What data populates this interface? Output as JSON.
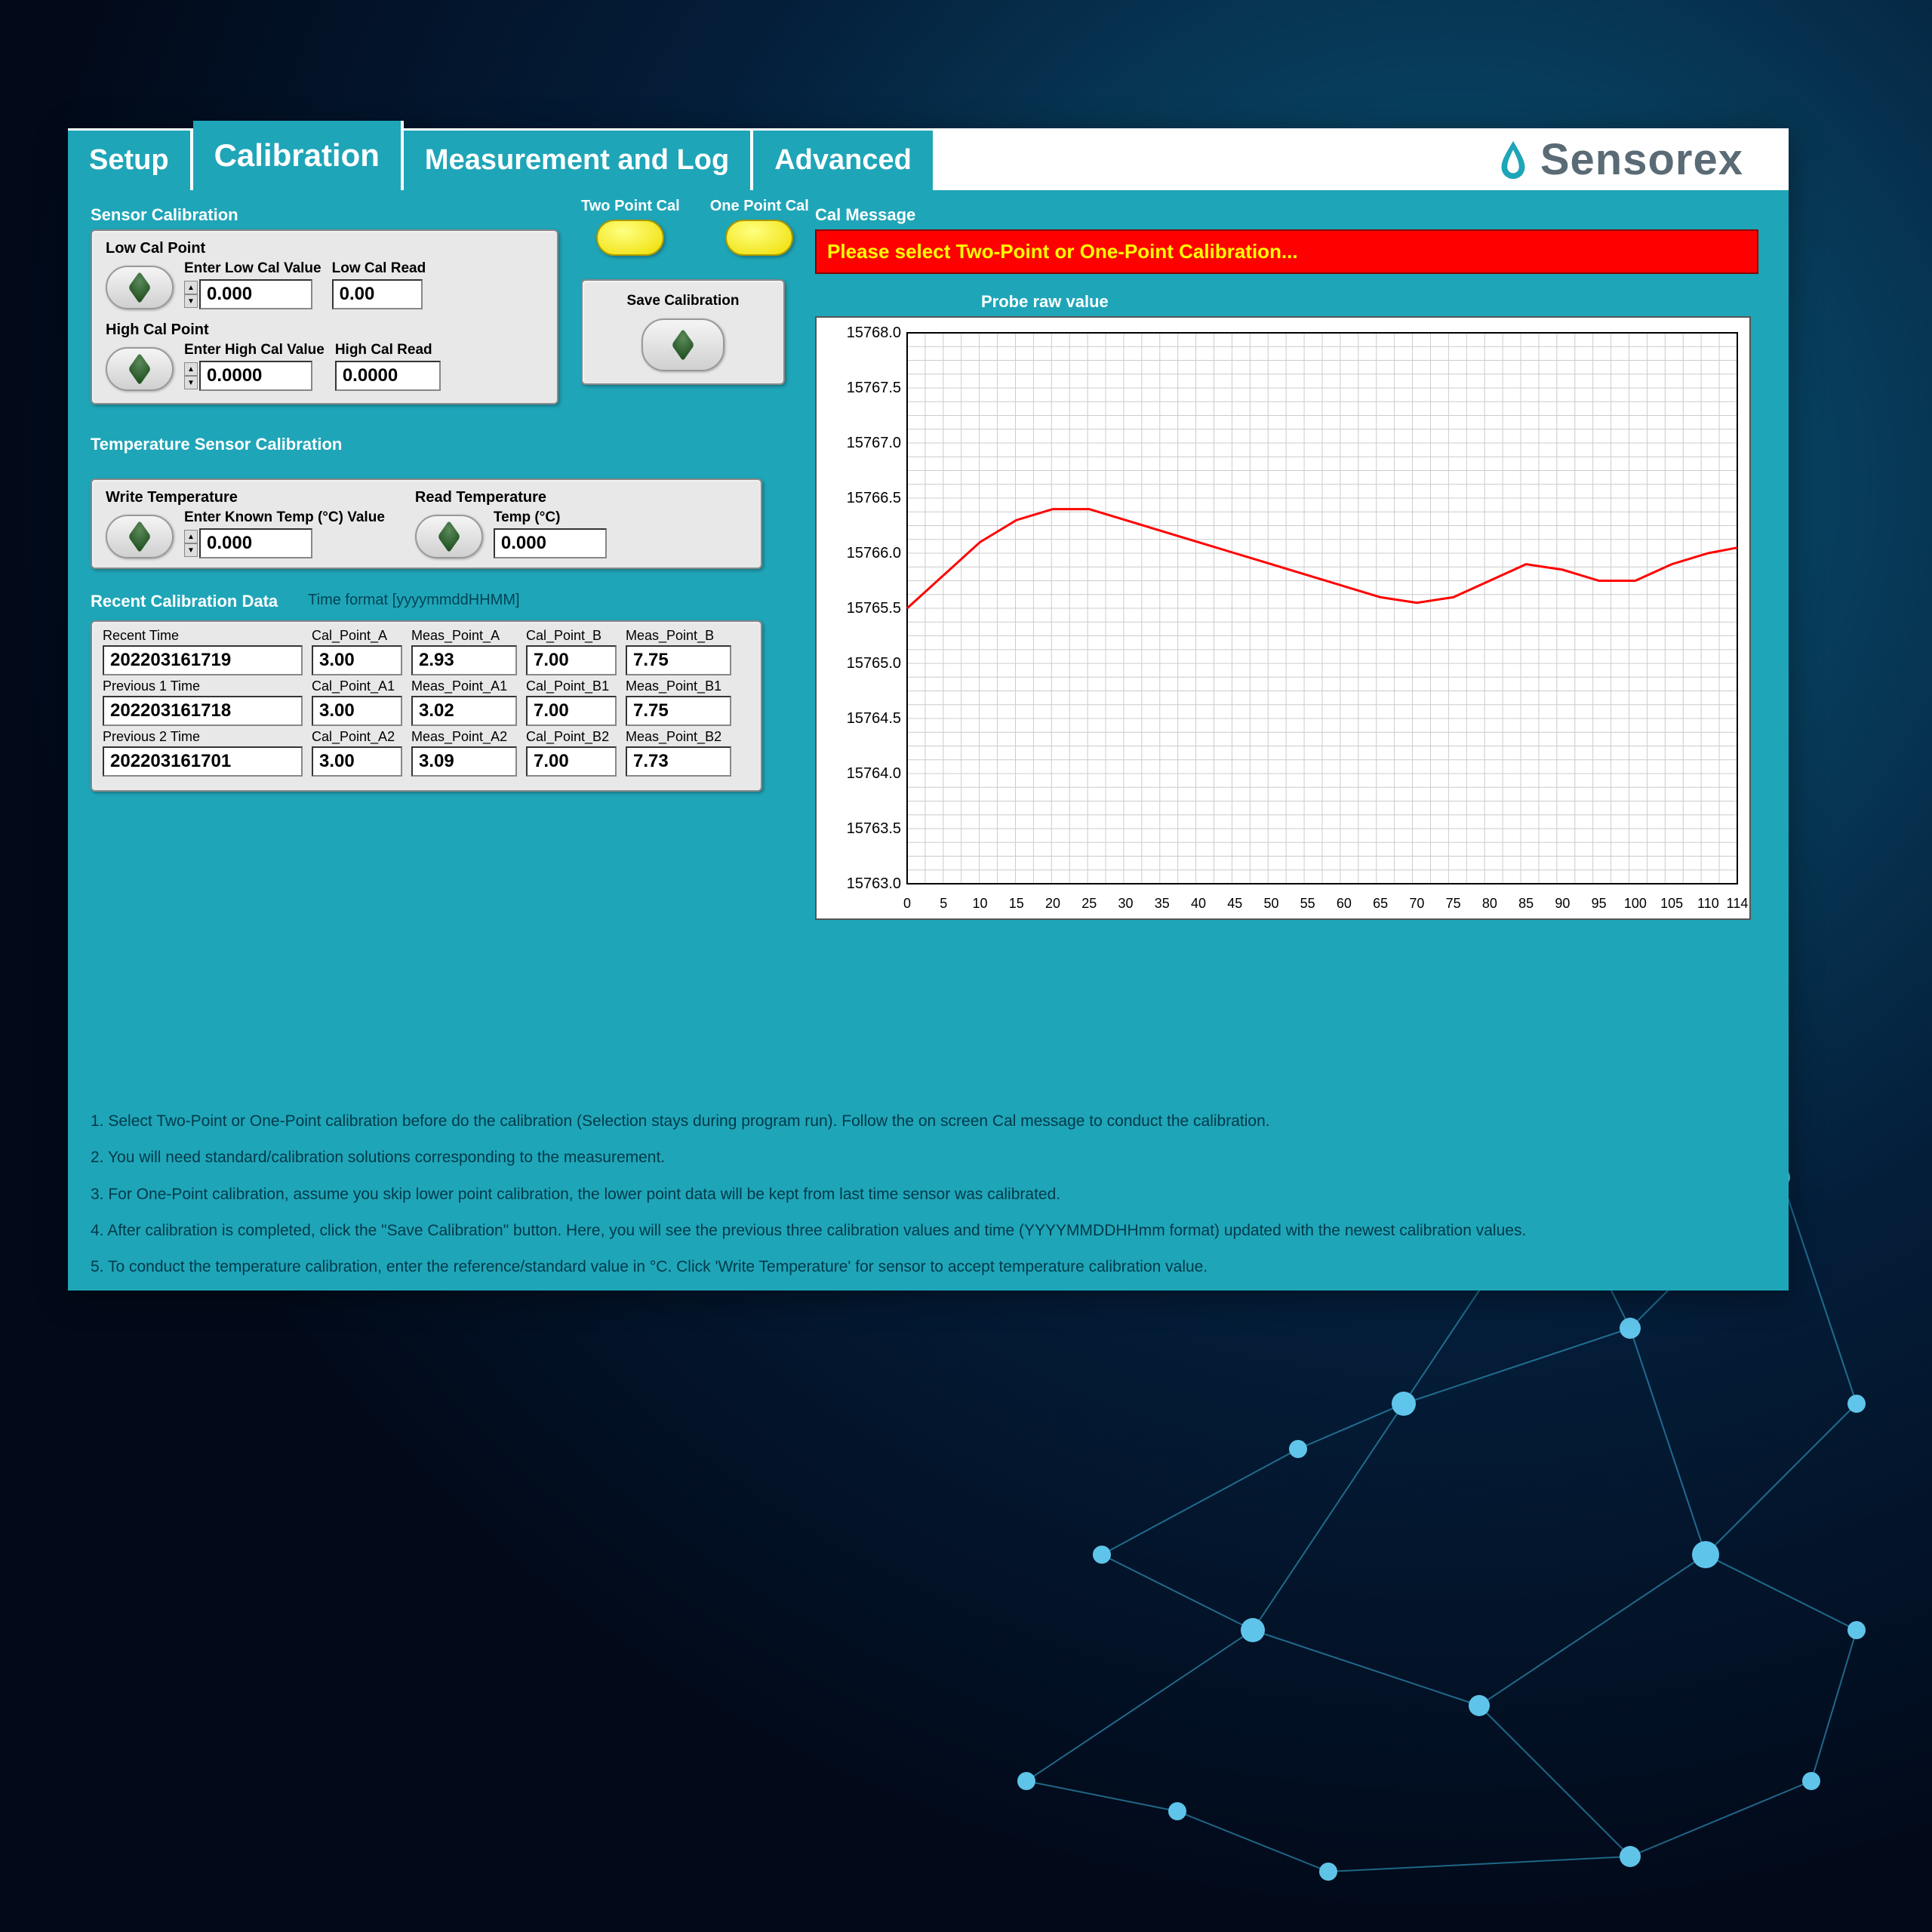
{
  "brand": "Sensorex",
  "tabs": {
    "setup": "Setup",
    "calibration": "Calibration",
    "measurement": "Measurement and Log",
    "advanced": "Advanced"
  },
  "sensor_cal": {
    "section": "Sensor Calibration",
    "low_point_label": "Low Cal Point",
    "enter_low_label": "Enter Low Cal Value",
    "enter_low_value": "0.000",
    "low_read_label": "Low Cal Read",
    "low_read_value": "0.00",
    "high_point_label": "High Cal Point",
    "enter_high_label": "Enter High Cal Value",
    "enter_high_value": "0.0000",
    "high_read_label": "High Cal Read",
    "high_read_value": "0.0000"
  },
  "cal_toggles": {
    "two_point": "Two Point Cal",
    "one_point": "One Point Cal"
  },
  "save_cal": {
    "label": "Save Calibration"
  },
  "temp_cal": {
    "section": "Temperature Sensor Calibration",
    "write_label": "Write Temperature",
    "known_label": "Enter Known Temp (°C) Value",
    "known_value": "0.000",
    "read_label": "Read Temperature",
    "temp_label": "Temp (°C)",
    "temp_value": "0.000"
  },
  "recent": {
    "section": "Recent Calibration Data",
    "time_format": "Time format [yyyymmddHHMM]",
    "rows": [
      {
        "time_label": "Recent Time",
        "time": "202203161719",
        "calA_label": "Cal_Point_A",
        "calA": "3.00",
        "measA_label": "Meas_Point_A",
        "measA": "2.93",
        "calB_label": "Cal_Point_B",
        "calB": "7.00",
        "measB_label": "Meas_Point_B",
        "measB": "7.75"
      },
      {
        "time_label": "Previous 1 Time",
        "time": "202203161718",
        "calA_label": "Cal_Point_A1",
        "calA": "3.00",
        "measA_label": "Meas_Point_A1",
        "measA": "3.02",
        "calB_label": "Cal_Point_B1",
        "calB": "7.00",
        "measB_label": "Meas_Point_B1",
        "measB": "7.75"
      },
      {
        "time_label": "Previous 2 Time",
        "time": "202203161701",
        "calA_label": "Cal_Point_A2",
        "calA": "3.00",
        "measA_label": "Meas_Point_A2",
        "measA": "3.09",
        "calB_label": "Cal_Point_B2",
        "calB": "7.00",
        "measB_label": "Meas_Point_B2",
        "measB": "7.73"
      }
    ]
  },
  "cal_message": {
    "label": "Cal Message",
    "text": "Please select Two-Point or One-Point  Calibration..."
  },
  "chart_data": {
    "type": "line",
    "title": "Probe raw value",
    "xlabel": "",
    "ylabel": "",
    "xlim": [
      0,
      114
    ],
    "ylim": [
      15763.0,
      15768.0
    ],
    "x_ticks": [
      0,
      5,
      10,
      15,
      20,
      25,
      30,
      35,
      40,
      45,
      50,
      55,
      60,
      65,
      70,
      75,
      80,
      85,
      90,
      95,
      100,
      105,
      110,
      114
    ],
    "y_ticks": [
      15763.0,
      15763.5,
      15764.0,
      15764.5,
      15765.0,
      15765.5,
      15766.0,
      15766.5,
      15767.0,
      15767.5,
      15768.0
    ],
    "series": [
      {
        "name": "Probe raw value",
        "color": "#ff0000",
        "x": [
          0,
          5,
          10,
          15,
          20,
          25,
          30,
          35,
          40,
          45,
          50,
          55,
          60,
          65,
          70,
          75,
          80,
          85,
          90,
          95,
          100,
          105,
          110,
          114
        ],
        "values": [
          15765.5,
          15765.8,
          15766.1,
          15766.3,
          15766.4,
          15766.4,
          15766.3,
          15766.2,
          15766.1,
          15766.0,
          15765.9,
          15765.8,
          15765.7,
          15765.6,
          15765.55,
          15765.6,
          15765.75,
          15765.9,
          15765.85,
          15765.75,
          15765.75,
          15765.9,
          15766.0,
          15766.05
        ]
      }
    ]
  },
  "instructions": {
    "l1": "1. Select Two-Point or One-Point calibration before do the calibration (Selection stays during program run). Follow the on screen Cal message to conduct the calibration.",
    "l2": "2. You will need standard/calibration solutions corresponding to the measurement.",
    "l3": "3. For One-Point calibration, assume you skip lower point calibration, the lower point data will be kept from last time sensor was calibrated.",
    "l4": "4. After calibration is completed, click the \"Save Calibration\" button. Here, you will see the previous three calibration values and time (YYYYMMDDHHmm format) updated with the newest  calibration values.",
    "l5": "5. To conduct the temperature calibration, enter the reference/standard value  in °C. Click 'Write Temperature' for sensor to accept temperature calibration value."
  }
}
